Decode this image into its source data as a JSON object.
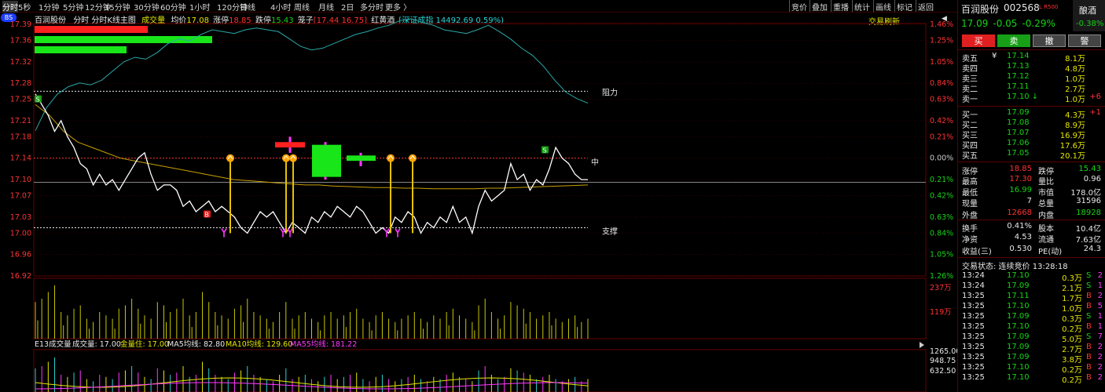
{
  "colors": {
    "up": "#ff3333",
    "down": "#17d317",
    "price_line": "#ffffff",
    "avg_line": "#c8a000",
    "index_line": "#2aa8a8",
    "axis": "#ff3333",
    "grid": "#3a0000"
  },
  "toolbar": {
    "periods": [
      "分时",
      "5秒",
      "1分钟",
      "5分钟",
      "12分钟",
      "15分钟",
      "30分钟",
      "60分钟",
      "1小时",
      "120分钟",
      "日线",
      "4小时",
      "周线",
      "月线",
      "2日",
      "多分时",
      "更多 〉"
    ],
    "right": [
      "竞价",
      "叠加",
      "重播",
      "统计",
      "画线",
      "标记",
      "返回"
    ]
  },
  "info_bar": {
    "name": "百润股份",
    "view": "分时 分时K线主图",
    "volume_label": "成交量",
    "avg_label": "均价",
    "avg_value": "17.08",
    "limit_up_label": "涨停",
    "limit_up_value": "18.85",
    "limit_down_label": "跌停",
    "limit_down_value": "15.43",
    "box_label": "笼子",
    "box_value": "[17.44 16.75]",
    "sector": "红黄酒",
    "index_text": "[深证成指 14492.69 0.59%)",
    "refresh": "交易刷新"
  },
  "badge": "BS",
  "price_axis": [
    "17.39",
    "17.36",
    "17.32",
    "17.28",
    "17.25",
    "17.21",
    "17.18",
    "17.14",
    "17.10",
    "17.07",
    "17.03",
    "17.00",
    "16.96",
    "16.92"
  ],
  "pct_axis": [
    "1.46%",
    "1.25%",
    "1.05%",
    "0.84%",
    "0.63%",
    "0.42%",
    "0.21%",
    "0.00%",
    "0.21%",
    "0.42%",
    "0.63%",
    "0.84%",
    "1.05%",
    "1.26%"
  ],
  "levels": {
    "resist": "阻力",
    "mid": "中",
    "support": "支撑"
  },
  "markers": {
    "s": "S",
    "b": "B"
  },
  "vol_axis": [
    "237万",
    "119万"
  ],
  "ma_bar": {
    "title": "E13成交量",
    "vol_label": "成交量: 17.00",
    "gold_label": "金量住: 17.00",
    "ma5": "MA5均线: 82.80",
    "ma10": "MA10均线: 129.60",
    "ma55": "MA55均线: 181.22"
  },
  "lower_axis": [
    "1265.00",
    "948.75",
    "632.50"
  ],
  "chart_data": {
    "type": "line",
    "price": [
      17.26,
      17.24,
      17.22,
      17.19,
      17.21,
      17.18,
      17.16,
      17.13,
      17.12,
      17.09,
      17.11,
      17.09,
      17.1,
      17.08,
      17.1,
      17.12,
      17.14,
      17.15,
      17.11,
      17.08,
      17.09,
      17.09,
      17.08,
      17.05,
      17.06,
      17.04,
      17.05,
      17.06,
      17.04,
      17.05,
      17.04,
      17.03,
      17.01,
      17.0,
      17.02,
      17.04,
      17.03,
      17.04,
      17.02,
      17.0,
      17.02,
      17.01,
      17.0,
      17.03,
      17.02,
      17.04,
      17.03,
      17.05,
      17.04,
      17.03,
      17.05,
      17.04,
      17.02,
      17.0,
      17.01,
      17.0,
      17.03,
      17.02,
      17.04,
      17.03,
      17.0,
      17.02,
      17.01,
      17.03,
      17.02,
      17.05,
      17.02,
      17.03,
      17.0,
      17.05,
      17.08,
      17.06,
      17.07,
      17.08,
      17.13,
      17.1,
      17.11,
      17.08,
      17.1,
      17.09,
      17.12,
      17.16,
      17.14,
      17.13,
      17.11,
      17.1,
      17.1
    ],
    "avg": [
      17.24,
      17.22,
      17.19,
      17.17,
      17.16,
      17.15,
      17.14,
      17.135,
      17.13,
      17.125,
      17.12,
      17.115,
      17.11,
      17.105,
      17.1,
      17.098,
      17.096,
      17.094,
      17.092,
      17.09,
      17.09,
      17.088,
      17.087,
      17.086,
      17.085,
      17.085,
      17.084,
      17.084,
      17.083,
      17.083,
      17.083,
      17.083,
      17.084,
      17.084,
      17.085,
      17.086,
      17.087,
      17.088,
      17.089,
      17.09
    ],
    "index_pct": [
      0.3,
      0.55,
      0.7,
      0.78,
      0.82,
      0.8,
      0.85,
      0.95,
      1.05,
      1.1,
      1.08,
      1.15,
      1.25,
      1.3,
      1.28,
      1.35,
      1.4,
      1.38,
      1.36,
      1.4,
      1.42,
      1.4,
      1.38,
      1.3,
      1.22,
      1.18,
      1.2,
      1.25,
      1.3,
      1.35,
      1.38,
      1.42,
      1.45,
      1.5,
      1.52,
      1.48,
      1.45,
      1.4,
      1.38,
      1.36,
      1.4,
      1.45,
      1.38,
      1.3,
      1.2,
      1.12,
      1.0,
      0.85,
      0.72,
      0.65,
      0.6
    ],
    "ylim": [
      16.92,
      17.39
    ],
    "volume": [
      55,
      60,
      70,
      80,
      40,
      35,
      45,
      50,
      30,
      25,
      40,
      35,
      30,
      45,
      50,
      60,
      45,
      35,
      30,
      55,
      50,
      40,
      45,
      60,
      35,
      40,
      70,
      55,
      40,
      35,
      30,
      45,
      50,
      60,
      40,
      35,
      30,
      25,
      40,
      55,
      30,
      35,
      40,
      30,
      25,
      35,
      40,
      30,
      35,
      40,
      45,
      30,
      25,
      35,
      40,
      30,
      25,
      30,
      35,
      40,
      30,
      25,
      35,
      30,
      40,
      45,
      35,
      30,
      25,
      50,
      60,
      40,
      30,
      35,
      55,
      50,
      45,
      40,
      30,
      35,
      40,
      30,
      25,
      30,
      35,
      25,
      30
    ]
  },
  "right_panel": {
    "name": "百润股份",
    "code": "002568",
    "tags": "L R500",
    "sector_tag": "酿酒",
    "price": "17.09",
    "change": "-0.05",
    "change_pct": "-0.29%",
    "sector_pct": "-0.38%",
    "buttons": [
      "买",
      "卖",
      "撤",
      "警"
    ],
    "asks": [
      {
        "label": "卖五",
        "unit": "¥",
        "price": "17.14",
        "vol": "8.1万",
        "delta": ""
      },
      {
        "label": "卖四",
        "unit": "",
        "price": "17.13",
        "vol": "4.8万",
        "delta": ""
      },
      {
        "label": "卖三",
        "unit": "",
        "price": "17.12",
        "vol": "1.0万",
        "delta": ""
      },
      {
        "label": "卖二",
        "unit": "",
        "price": "17.11",
        "vol": "2.7万",
        "delta": ""
      },
      {
        "label": "卖一",
        "unit": "",
        "price": "17.10 ↓",
        "vol": "1.0万",
        "delta": "+6"
      }
    ],
    "bids": [
      {
        "label": "买一",
        "price": "17.09",
        "vol": "4.3万",
        "delta": "+1"
      },
      {
        "label": "买二",
        "price": "17.08",
        "vol": "8.9万",
        "delta": ""
      },
      {
        "label": "买三",
        "price": "17.07",
        "vol": "16.9万",
        "delta": ""
      },
      {
        "label": "买四",
        "price": "17.06",
        "vol": "17.6万",
        "delta": ""
      },
      {
        "label": "买五",
        "price": "17.05",
        "vol": "20.1万",
        "delta": ""
      }
    ],
    "stats": [
      {
        "l1": "涨停",
        "v1": "18.85",
        "l2": "跌停",
        "v2": "15.43",
        "c1": "red",
        "c2": "green"
      },
      {
        "l1": "最高",
        "v1": "17.30",
        "l2": "量比",
        "v2": "0.96",
        "c1": "red",
        "c2": "white"
      },
      {
        "l1": "最低",
        "v1": "16.99",
        "l2": "市值",
        "v2": "178.0亿",
        "c1": "green",
        "c2": "white"
      },
      {
        "l1": "现量",
        "v1": "7",
        "l2": "总量",
        "v2": "31596",
        "c1": "white",
        "c2": "white"
      },
      {
        "l1": "外盘",
        "v1": "12668",
        "l2": "内盘",
        "v2": "18928",
        "c1": "red",
        "c2": "green"
      },
      {
        "l1": "换手",
        "v1": "0.41%",
        "l2": "股本",
        "v2": "10.4亿",
        "c1": "white",
        "c2": "white"
      },
      {
        "l1": "净资",
        "v1": "4.53",
        "l2": "流通",
        "v2": "7.63亿",
        "c1": "white",
        "c2": "white"
      },
      {
        "l1": "收益(三)",
        "v1": "0.530",
        "l2": "PE(动)",
        "v2": "24.3",
        "c1": "white",
        "c2": "white"
      }
    ],
    "trade_status": "交易状态: 连续竞价 13:28:18",
    "ticks": [
      {
        "t": "13:24",
        "p": "17.10",
        "v": "0.3万",
        "s": "S",
        "n": "2"
      },
      {
        "t": "13:24",
        "p": "17.09",
        "v": "2.1万",
        "s": "S",
        "n": "1"
      },
      {
        "t": "13:25",
        "p": "17.11",
        "v": "1.7万",
        "s": "B",
        "n": "2"
      },
      {
        "t": "13:25",
        "p": "17.10",
        "v": "1.0万",
        "s": "B",
        "n": "5"
      },
      {
        "t": "13:25",
        "p": "17.09",
        "v": "0.3万",
        "s": "S",
        "n": "1"
      },
      {
        "t": "13:25",
        "p": "17.10",
        "v": "0.2万",
        "s": "B",
        "n": "1"
      },
      {
        "t": "13:25",
        "p": "17.09",
        "v": "5.0万",
        "s": "S",
        "n": "7"
      },
      {
        "t": "13:25",
        "p": "17.09",
        "v": "2.7万",
        "s": "B",
        "n": "2"
      },
      {
        "t": "13:25",
        "p": "17.09",
        "v": "3.8万",
        "s": "B",
        "n": "2"
      },
      {
        "t": "13:25",
        "p": "17.10",
        "v": "0.2万",
        "s": "B",
        "n": "2"
      },
      {
        "t": "13:25",
        "p": "17.10",
        "v": "0.2万",
        "s": "B",
        "n": "2"
      }
    ]
  }
}
